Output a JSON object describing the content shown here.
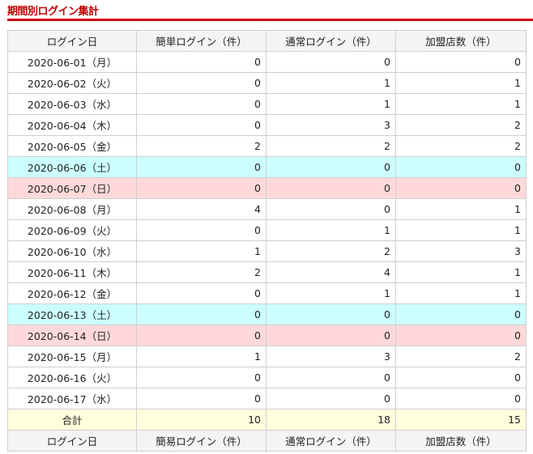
{
  "title": "期間別ログイン集計",
  "colors": {
    "accent": "#d40000",
    "saturday": "#ccffff",
    "sunday": "#ffd9d9",
    "total": "#ffffdd",
    "header": "#f3f4f3"
  },
  "header": [
    "ログイン日",
    "簡単ログイン（件）",
    "通常ログイン（件）",
    "加盟店数（件）"
  ],
  "footer_header": [
    "ログイン日",
    "簡易ログイン（件）",
    "通常ログイン（件）",
    "加盟店数（件）"
  ],
  "rows": [
    {
      "date": "2020-06-01（月）",
      "easy": "0",
      "normal": "0",
      "stores": "0",
      "type": ""
    },
    {
      "date": "2020-06-02（火）",
      "easy": "0",
      "normal": "1",
      "stores": "1",
      "type": ""
    },
    {
      "date": "2020-06-03（水）",
      "easy": "0",
      "normal": "1",
      "stores": "1",
      "type": ""
    },
    {
      "date": "2020-06-04（木）",
      "easy": "0",
      "normal": "3",
      "stores": "2",
      "type": ""
    },
    {
      "date": "2020-06-05（金）",
      "easy": "2",
      "normal": "2",
      "stores": "2",
      "type": ""
    },
    {
      "date": "2020-06-06（土）",
      "easy": "0",
      "normal": "0",
      "stores": "0",
      "type": "sat"
    },
    {
      "date": "2020-06-07（日）",
      "easy": "0",
      "normal": "0",
      "stores": "0",
      "type": "sun"
    },
    {
      "date": "2020-06-08（月）",
      "easy": "4",
      "normal": "0",
      "stores": "1",
      "type": ""
    },
    {
      "date": "2020-06-09（火）",
      "easy": "0",
      "normal": "1",
      "stores": "1",
      "type": ""
    },
    {
      "date": "2020-06-10（水）",
      "easy": "1",
      "normal": "2",
      "stores": "3",
      "type": ""
    },
    {
      "date": "2020-06-11（木）",
      "easy": "2",
      "normal": "4",
      "stores": "1",
      "type": ""
    },
    {
      "date": "2020-06-12（金）",
      "easy": "0",
      "normal": "1",
      "stores": "1",
      "type": ""
    },
    {
      "date": "2020-06-13（土）",
      "easy": "0",
      "normal": "0",
      "stores": "0",
      "type": "sat"
    },
    {
      "date": "2020-06-14（日）",
      "easy": "0",
      "normal": "0",
      "stores": "0",
      "type": "sun"
    },
    {
      "date": "2020-06-15（月）",
      "easy": "1",
      "normal": "3",
      "stores": "2",
      "type": ""
    },
    {
      "date": "2020-06-16（火）",
      "easy": "0",
      "normal": "0",
      "stores": "0",
      "type": ""
    },
    {
      "date": "2020-06-17（水）",
      "easy": "0",
      "normal": "0",
      "stores": "0",
      "type": ""
    }
  ],
  "total": {
    "label": "合計",
    "easy": "10",
    "normal": "18",
    "stores": "15"
  }
}
